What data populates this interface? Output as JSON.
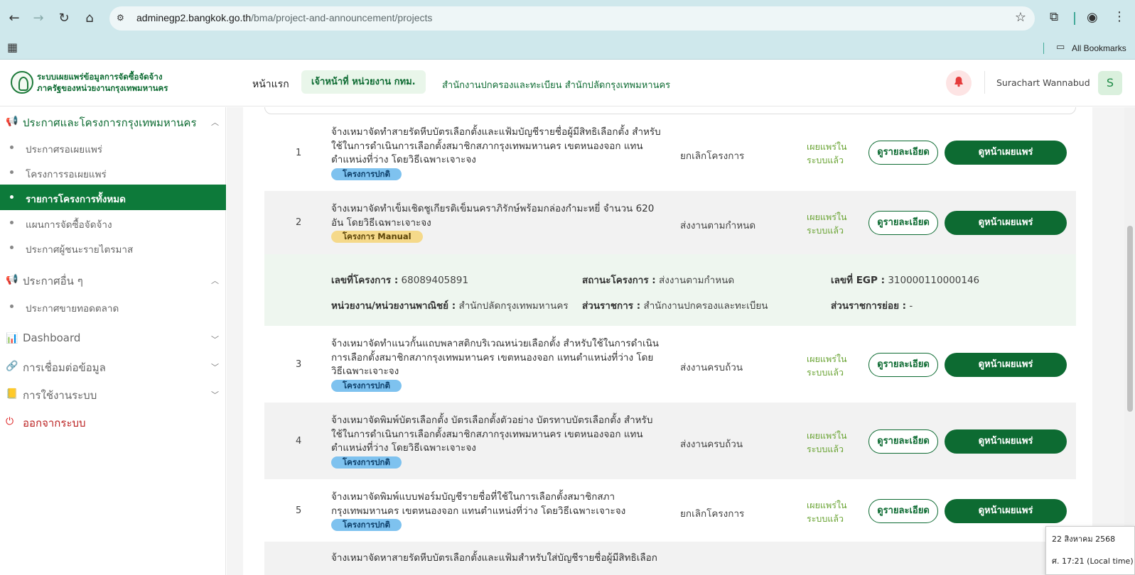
{
  "browser": {
    "url_host": "adminegp2.bangkok.go.th",
    "url_path": "/bma/project-and-announcement/projects",
    "bookmarks_label": "All Bookmarks"
  },
  "header": {
    "logo_line1": "ระบบเผยแพร่ข้อมูลการจัดซื้อจัดจ้าง",
    "logo_line2": "ภาครัฐของหน่วยงานกรุงเทพมหานคร",
    "nav_home": "หน้าแรก",
    "role": "เจ้าหน้าที่ หน่วยงาน กทม.",
    "department": "สำนักงานปกครองและทะเบียน สำนักปลัดกรุงเทพมหานคร",
    "user_name": "Surachart Wannabud",
    "avatar_letter": "S"
  },
  "sidebar": {
    "section1_title": "ประกาศและโครงการกรุงเทพมหานคร",
    "section1_items": [
      "ประกาศรอเผยแพร่",
      "โครงการรอเผยแพร่",
      "รายการโครงการทั้งหมด",
      "แผนการจัดซื้อจัดจ้าง",
      "ประกาศผู้ชนะรายไตรมาส"
    ],
    "section2_title": "ประกาศอื่น ๆ",
    "section2_items": [
      "ประกาศขายทอดตลาด"
    ],
    "dashboard": "Dashboard",
    "data_link": "การเชื่อมต่อข้อมูล",
    "usage": "การใช้งานระบบ",
    "logout": "ออกจากระบบ"
  },
  "buttons": {
    "details": "ดูรายละเอียด",
    "view_page": "ดูหน้าเผยแพร่"
  },
  "projects": [
    {
      "num": "1",
      "title": "จ้างเหมาจัดทำสายรัดหีบบัตรเลือกตั้งและแฟ้มบัญชีรายชื่อผู้มีสิทธิเลือกตั้ง สำหรับใช้ในการดำเนินการเลือกตั้งสมาชิกสภากรุงเทพมหานคร เขตหนองจอก แทนตำแหน่งที่ว่าง โดยวิธีเฉพาะเจาะจง",
      "tag": "โครงการปกติ",
      "status": "ยกเลิกโครงการ",
      "published": "เผยแพร่ในระบบแล้ว"
    },
    {
      "num": "2",
      "title": "จ้างเหมาจัดทำเข็มเชิดชูเกียรติเข็มนคราภิรักษ์พร้อมกล่องกำมะหยี่ จำนวน 620 อัน โดยวิธีเฉพาะเจาะจง",
      "tag": "โครงการ Manual",
      "status": "ส่งงานตามกำหนด",
      "published": "เผยแพร่ในระบบแล้ว"
    },
    {
      "num": "3",
      "title": "จ้างเหมาจัดทำแนวกั้นแถบพลาสติกบริเวณหน่วยเลือกตั้ง สำหรับใช้ในการดำเนินการเลือกตั้งสมาชิกสภากรุงเทพมหานคร เขตหนองจอก แทนตำแหน่งที่ว่าง โดยวิธีเฉพาะเจาะจง",
      "tag": "โครงการปกติ",
      "status": "ส่งงานครบถ้วน",
      "published": "เผยแพร่ในระบบแล้ว"
    },
    {
      "num": "4",
      "title": "จ้างเหมาจัดพิมพ์บัตรเลือกตั้ง บัตรเลือกตั้งตัวอย่าง บัตรทาบบัตรเลือกตั้ง สำหรับใช้ในการดำเนินการเลือกตั้งสมาชิกสภากรุงเทพมหานคร เขตหนองจอก แทนตำแหน่งที่ว่าง โดยวิธีเฉพาะเจาะจง",
      "tag": "โครงการปกติ",
      "status": "ส่งงานครบถ้วน",
      "published": "เผยแพร่ในระบบแล้ว"
    },
    {
      "num": "5",
      "title": "จ้างเหมาจัดพิมพ์แบบฟอร์มบัญชีรายชื่อที่ใช้ในการเลือกตั้งสมาชิกสภากรุงเทพมหานคร เขตหนองจอก แทนตำแหน่งที่ว่าง โดยวิธีเฉพาะเจาะจง",
      "tag": "โครงการปกติ",
      "status": "ยกเลิกโครงการ",
      "published": "เผยแพร่ในระบบแล้ว"
    },
    {
      "num": "",
      "title": "จ้างเหมาจัดหาสายรัดหีบบัตรเลือกตั้งและแฟ้มสำหรับใส่บัญชีรายชื่อผู้มีสิทธิเลือก"
    }
  ],
  "detail": {
    "project_no_label": "เลขที่โครงการ :",
    "project_no": "68089405891",
    "status_label": "สถานะโครงการ :",
    "status": "ส่งงานตามกำหนด",
    "egp_label": "เลขที่ EGP :",
    "egp": "310000110000146",
    "agency_label": "หน่วยงาน/หน่วยงานพาณิชย์ :",
    "agency": "สำนักปลัดกรุงเทพมหานคร",
    "division_label": "ส่วนราชการ :",
    "division": "สำนักงานปกครองและทะเบียน",
    "subdivision_label": "ส่วนราชการย่อย :",
    "subdivision": "-"
  },
  "clock": {
    "date": "22 สิงหาคม 2568",
    "time": "ศ. 17:21 (Local time)"
  },
  "colors": {
    "brand_green": "#0d6b32",
    "chrome": "#cfe8ec",
    "tag_normal": "#7ec2ef",
    "tag_manual": "#f5d98a",
    "published_green": "#6aa434"
  }
}
